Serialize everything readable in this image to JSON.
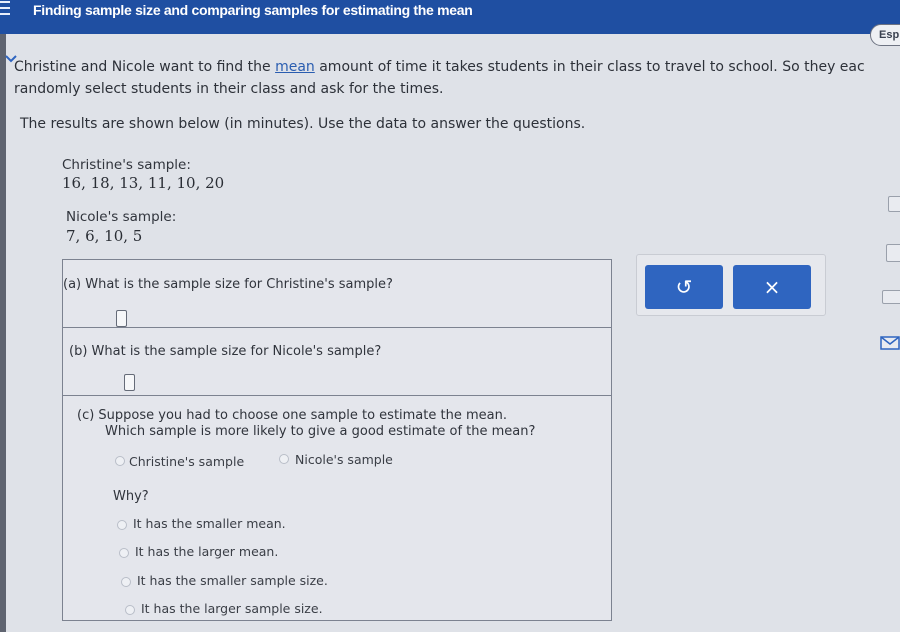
{
  "header": {
    "title": "Finding sample size and comparing samples for estimating the mean",
    "language_button": "Esp"
  },
  "problem": {
    "intro_before_link": "Christine and Nicole want to find the ",
    "intro_link": "mean",
    "intro_after_link": " amount of time it takes students in their class to travel to school. So they eac",
    "intro_line2": "randomly select students in their class and ask for the times.",
    "instructions": "The results are shown below (in minutes). Use the data to answer the questions.",
    "christine_label": "Christine's sample:",
    "christine_data": "16, 18, 13, 11, 10, 20",
    "nicole_label": "Nicole's sample:",
    "nicole_data": "7, 6, 10, 5"
  },
  "questions": {
    "a": "(a) What is the sample size for Christine's sample?",
    "a_value": "",
    "b": "(b) What is the sample size for Nicole's sample?",
    "b_value": "",
    "c_line1": "(c) Suppose you had to choose one sample to estimate the mean.",
    "c_line2": "Which sample is more likely to give a good estimate of the mean?",
    "choice_options": [
      "Christine's sample",
      "Nicole's sample"
    ],
    "why_label": "Why?",
    "why_options": [
      "It has the smaller mean.",
      "It has the larger mean.",
      "It has the smaller sample size.",
      "It has the larger sample size."
    ]
  },
  "actions": {
    "undo_icon": "undo-icon",
    "clear_icon": "close-icon",
    "undo_symbol": "↺",
    "clear_symbol": "×"
  },
  "colors": {
    "header_bg": "#1f4fa2",
    "button_blue": "#2f65c0",
    "page_bg": "#dfe2e8"
  }
}
